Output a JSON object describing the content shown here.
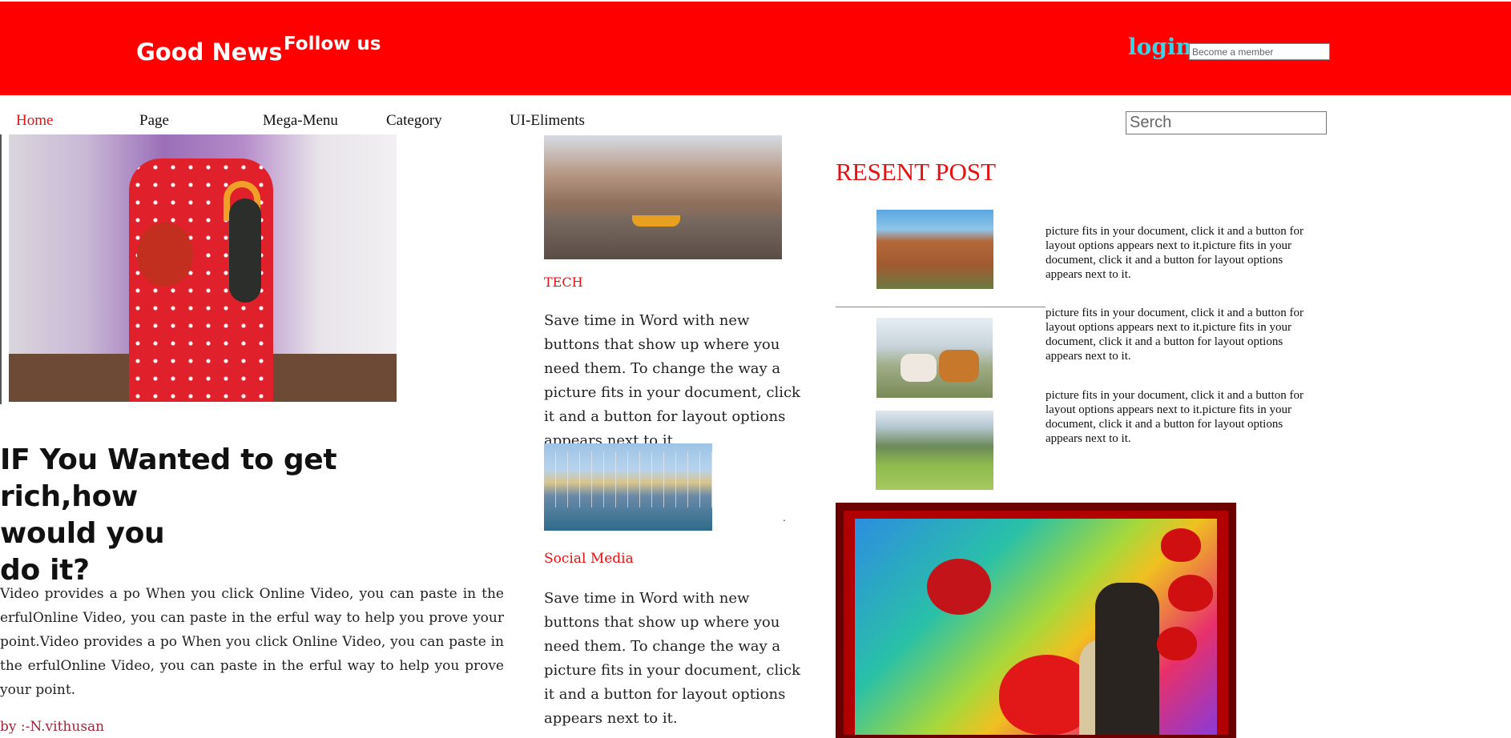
{
  "header": {
    "brand": "Good News",
    "follow": "Follow us",
    "login": "login",
    "member_placeholder": "Become a member",
    "background": "#ff0000"
  },
  "nav": {
    "items": [
      {
        "label": "Home",
        "active": true
      },
      {
        "label": "Page",
        "active": false
      },
      {
        "label": "Mega-Menu",
        "active": false
      },
      {
        "label": "Category",
        "active": false
      },
      {
        "label": "UI-Eliments",
        "active": false
      }
    ],
    "search_placeholder": "Serch"
  },
  "main": {
    "headline_lines": [
      "IF You Wanted to get rich,how",
      "would you",
      "do it?"
    ],
    "body": "Video provides a po When you click Online Video, you can paste in the erfulOnline Video, you can paste in the erful way to help you prove your point.Video provides a po When you click Online Video, you can paste in the erfulOnline Video, you can paste in the erful way to help you prove your point.",
    "byline": "by :-N.vithusan"
  },
  "middle": {
    "posts": [
      {
        "category": "TECH",
        "text": "Save time in Word with new buttons that show up where you need them. To change the way a picture fits in your document, click it and a button for layout options appears next to it."
      },
      {
        "category": "Social Media",
        "text": "Save time in Word with new buttons that show up where you need them. To change the way a picture fits in your document, click it and a button for layout options appears next to it."
      }
    ],
    "dot": "."
  },
  "sidebar": {
    "title": "RESENT POST",
    "items": [
      {
        "text": "picture fits in your document, click it and a button for layout options appears next to it.picture fits in your document, click it and a button for layout options appears next to it."
      },
      {
        "text": "picture fits in your document, click it and a button for layout options appears next to it.picture fits in your document, click it and a button for layout options appears next to it."
      },
      {
        "text": "picture fits in your document, click it and a button for layout options appears next to it.picture fits in your document, click it and a button for layout options appears next to it."
      }
    ]
  },
  "colors": {
    "accent_red": "#e81010",
    "login_cyan": "#33d6e8",
    "byline": "#a0283a"
  }
}
